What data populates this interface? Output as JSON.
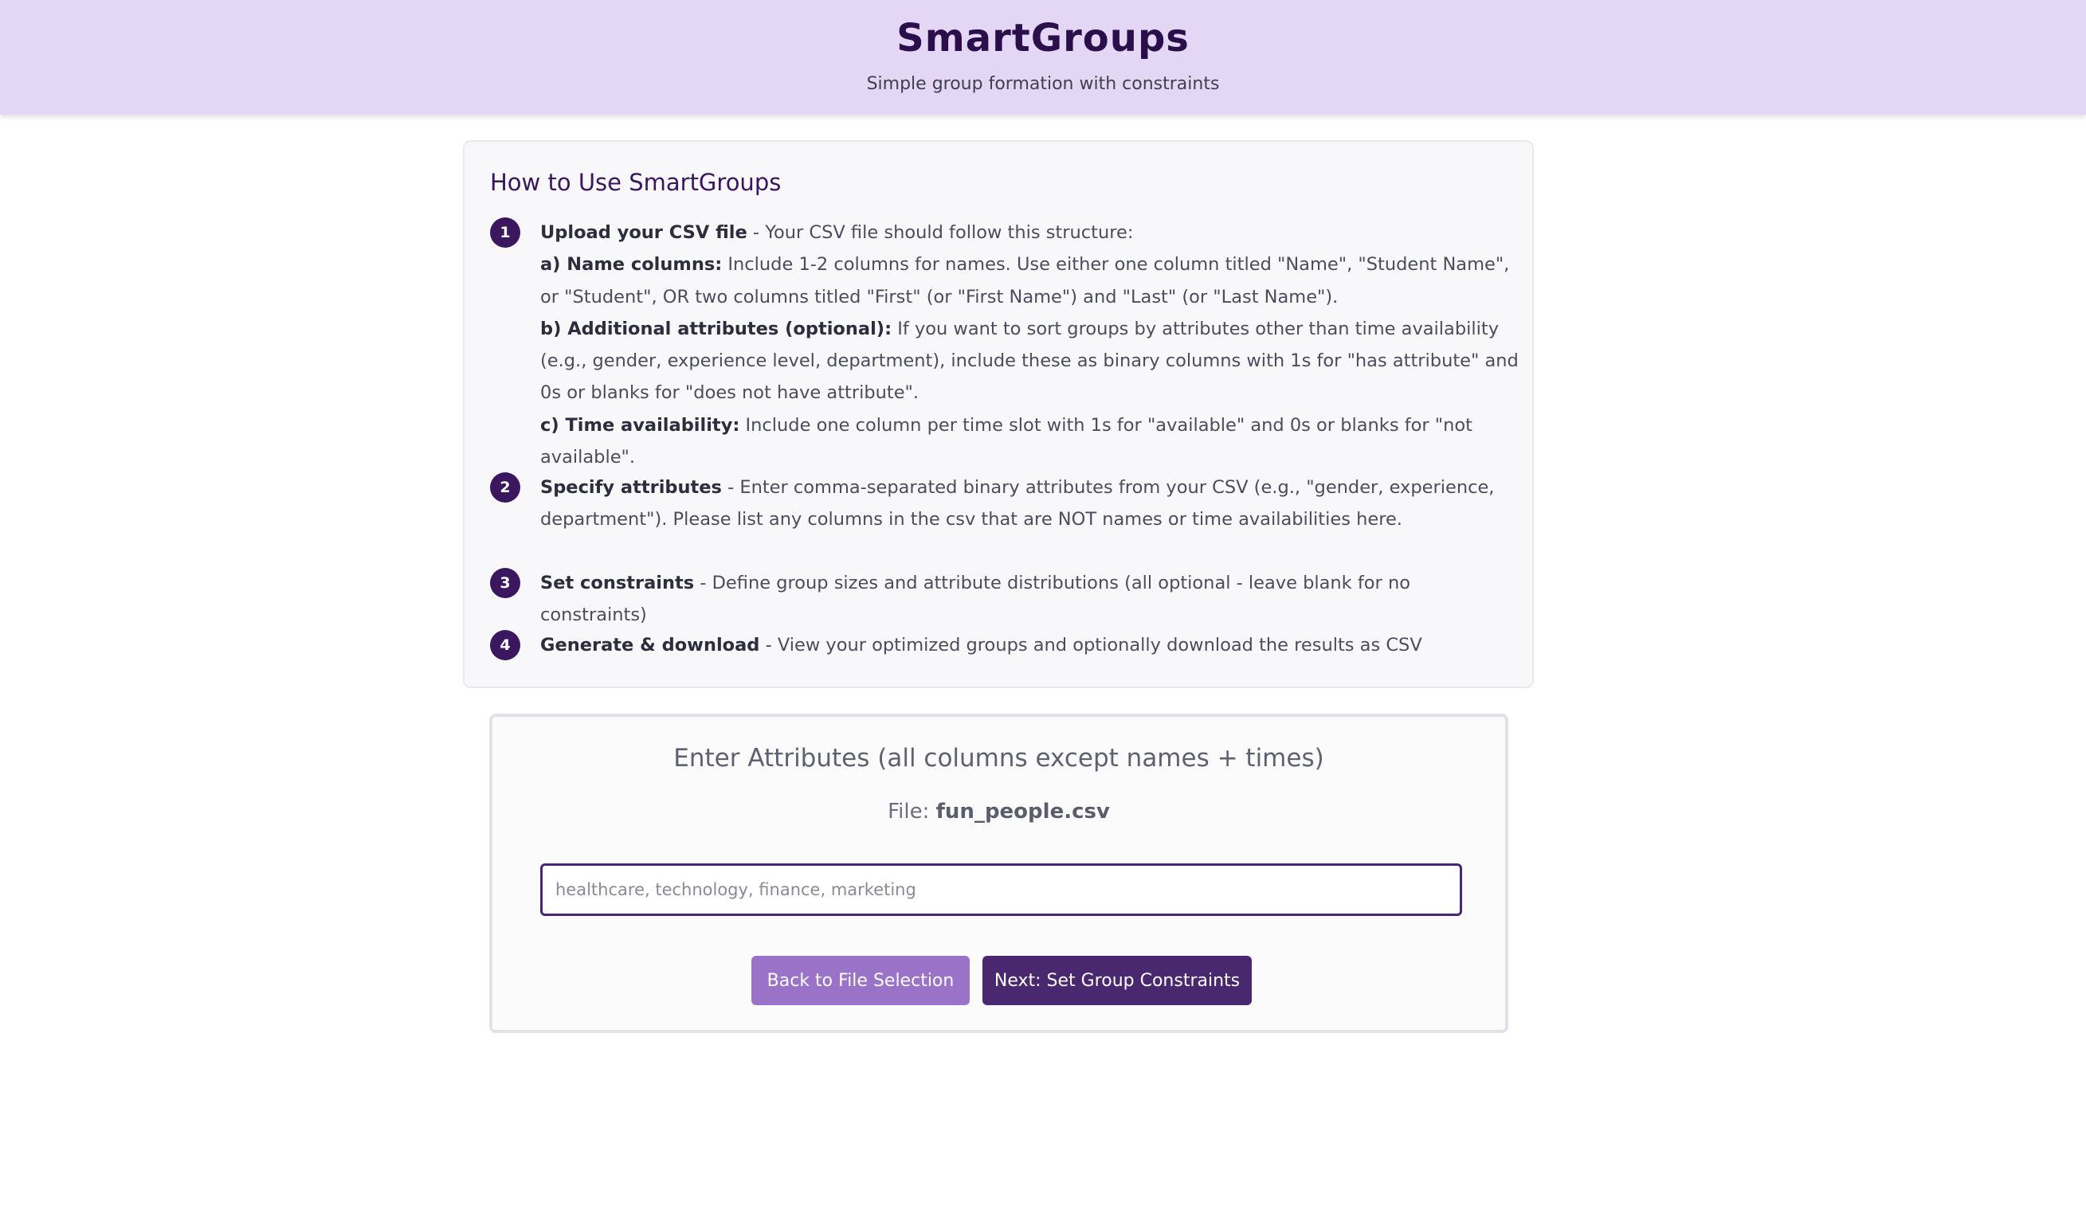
{
  "header": {
    "title": "SmartGroups",
    "subtitle": "Simple group formation with constraints"
  },
  "instructions": {
    "title": "How to Use SmartGroups",
    "steps": [
      {
        "number": "1",
        "bold": "Upload your CSV file",
        "text": " - Your CSV file should follow this structure:",
        "subitems": [
          {
            "bold": "a) Name columns:",
            "text": " Include 1-2 columns for names. Use either one column titled \"Name\", \"Student Name\", or \"Student\", OR two columns titled \"First\" (or \"First Name\") and \"Last\" (or \"Last Name\")."
          },
          {
            "bold": "b) Additional attributes (optional):",
            "text": " If you want to sort groups by attributes other than time availability (e.g., gender, experience level, department), include these as binary columns with 1s for \"has attribute\" and 0s or blanks for \"does not have attribute\"."
          },
          {
            "bold": "c) Time availability:",
            "text": " Include one column per time slot with 1s for \"available\" and 0s or blanks for \"not available\"."
          }
        ]
      },
      {
        "number": "2",
        "bold": "Specify attributes",
        "text": " - Enter comma-separated binary attributes from your CSV (e.g., \"gender, experience, department\"). Please list any columns in the csv that are NOT names or time availabilities here."
      },
      {
        "number": "3",
        "bold": "Set constraints",
        "text": " - Define group sizes and attribute distributions (all optional - leave blank for no constraints)"
      },
      {
        "number": "4",
        "bold": "Generate & download",
        "text": " - View your optimized groups and optionally download the results as CSV"
      }
    ]
  },
  "attributes_form": {
    "title": "Enter Attributes (all columns except names + times)",
    "file_label": "File:",
    "file_name": "fun_people.csv",
    "input_value": "",
    "input_placeholder": "healthcare, technology, finance, marketing",
    "back_button_label": "Back to File Selection",
    "next_button_label": "Next: Set Group Constraints"
  },
  "colors": {
    "header_bg": "#e4d7f5",
    "accent_dark": "#3b1760",
    "back_button": "#9a72c8",
    "next_button": "#4a2870"
  }
}
